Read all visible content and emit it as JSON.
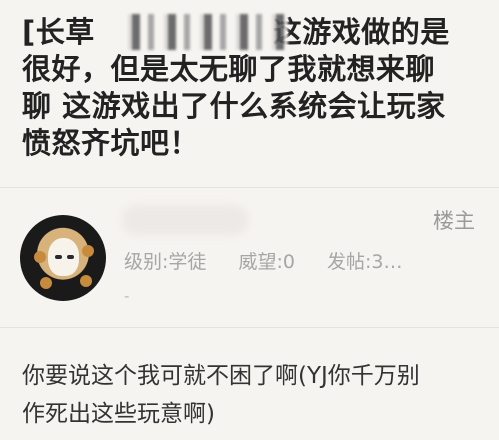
{
  "thread": {
    "title_lines": [
      "[长草",
      "很好，但是太无聊了我就想来聊",
      "聊 这游戏出了什么系统会让玩家",
      "愤怒齐坑吧！"
    ],
    "title_line1_suffix": "这游戏做的是"
  },
  "post": {
    "floor_label": "楼主",
    "meta": {
      "level": "级别:学徒",
      "prestige": "威望:0",
      "posts": "发帖:3…"
    },
    "dash": "-",
    "reply_lines": [
      "你要说这个我可就不困了啊(YJ你千万别",
      "作死出这些玩意啊)"
    ]
  },
  "colors": {
    "background": "#f6f4f1",
    "title": "#222222",
    "meta": "#a6a6a6",
    "body": "#333333"
  }
}
